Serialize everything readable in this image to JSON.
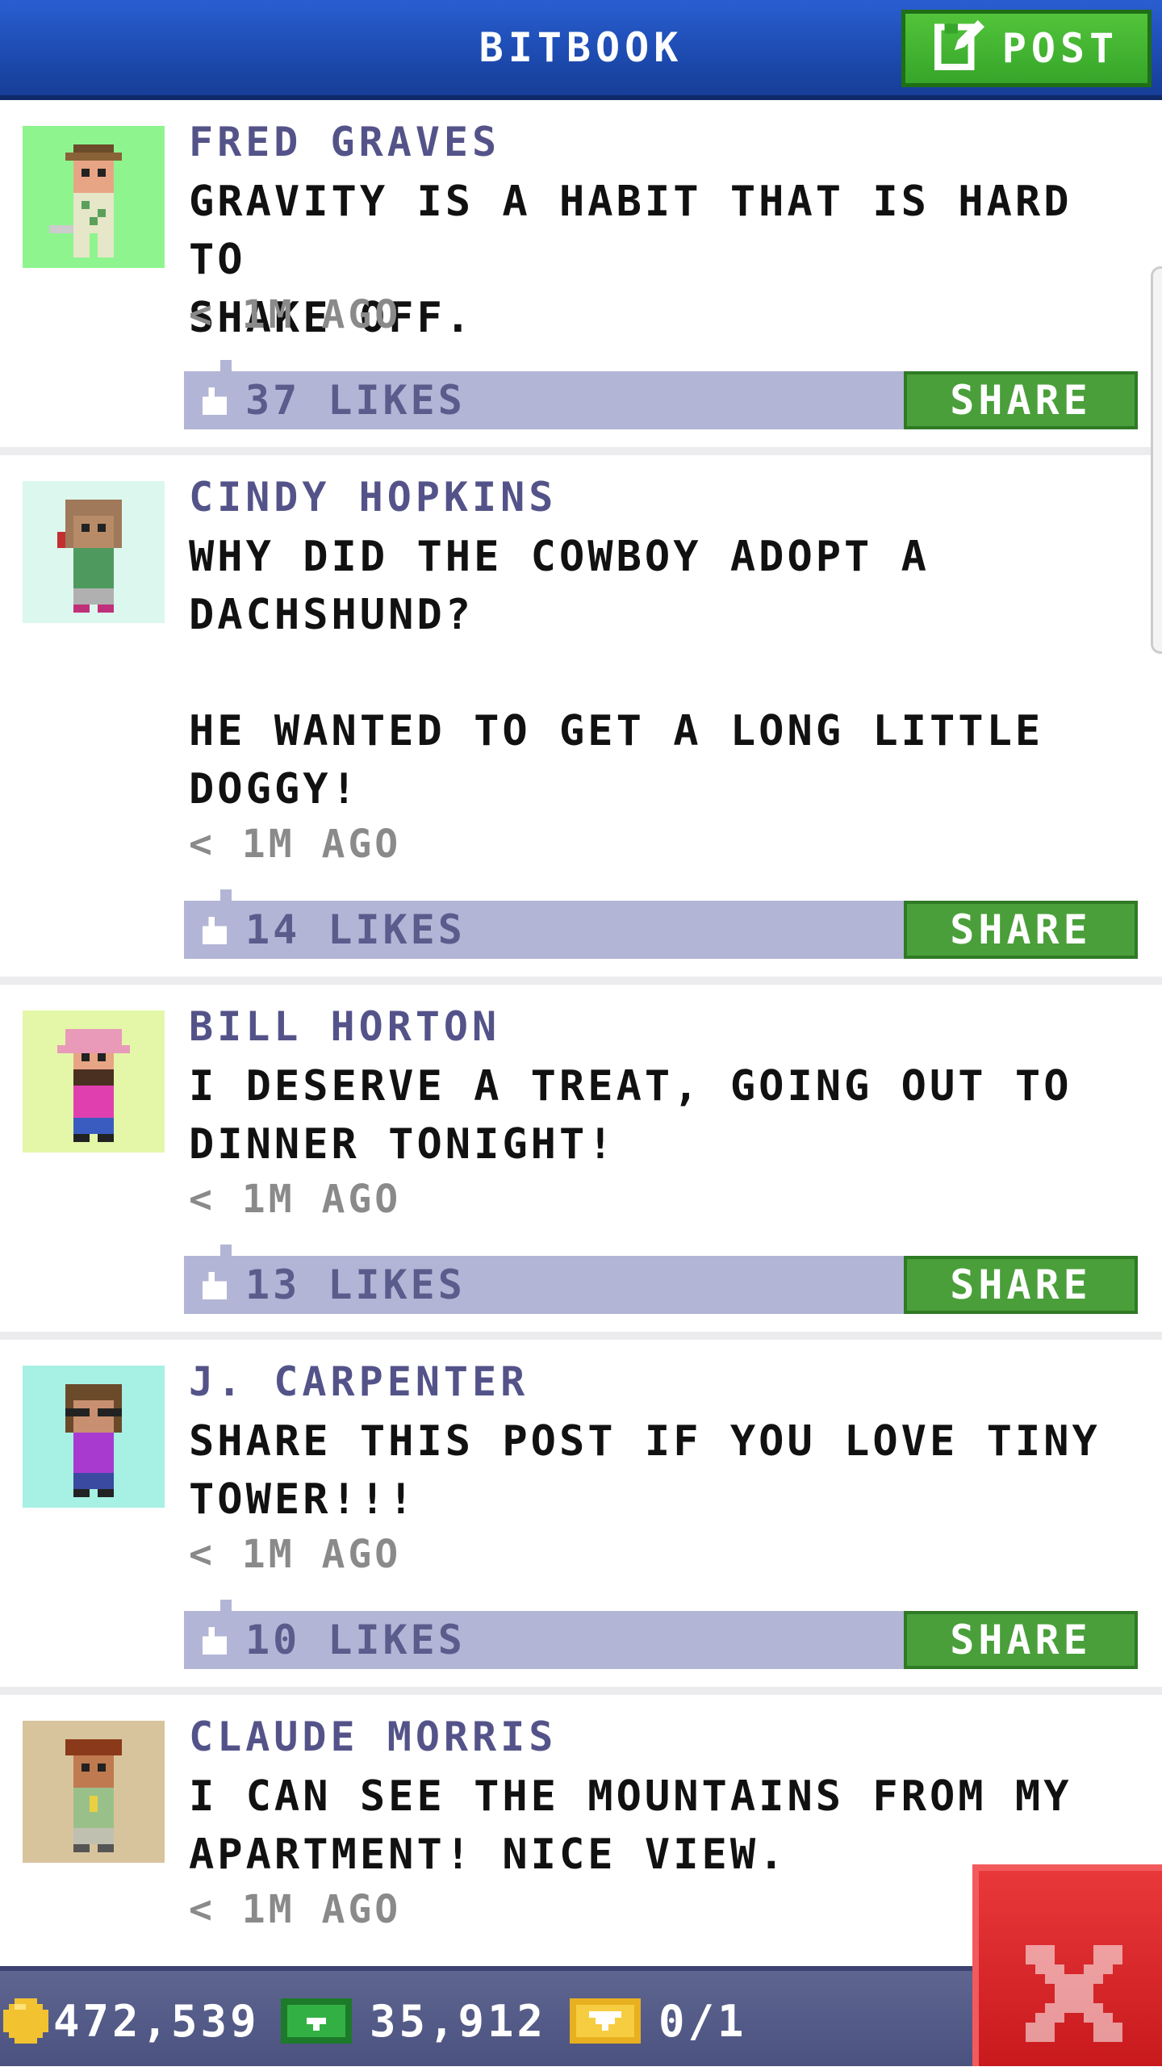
{
  "header": {
    "title": "BITBOOK",
    "post_label": "POST",
    "post_icon": "edit-icon"
  },
  "posts": [
    {
      "author": "FRED GRAVES",
      "message": "GRAVITY IS A HABIT THAT IS HARD TO\nSHAKE OFF.",
      "time": "< 1M AGO",
      "likes": "37 LIKES",
      "share_label": "SHARE",
      "avatar_bg": "#8ef58e"
    },
    {
      "author": "CINDY HOPKINS",
      "message": "WHY DID THE COWBOY ADOPT A\nDACHSHUND?\n\nHE WANTED TO GET A LONG LITTLE\nDOGGY!",
      "time": "< 1M AGO",
      "likes": "14 LIKES",
      "share_label": "SHARE",
      "avatar_bg": "#dcf7ee"
    },
    {
      "author": "BILL HORTON",
      "message": "I DESERVE A TREAT, GOING OUT TO\nDINNER TONIGHT!",
      "time": "< 1M AGO",
      "likes": "13 LIKES",
      "share_label": "SHARE",
      "avatar_bg": "#e4f7a8"
    },
    {
      "author": "J. CARPENTER",
      "message": "SHARE THIS POST IF YOU LOVE TINY\nTOWER!!!",
      "time": "< 1M AGO",
      "likes": "10 LIKES",
      "share_label": "SHARE",
      "avatar_bg": "#a6f0e4"
    },
    {
      "author": "CLAUDE MORRIS",
      "message": "I CAN SEE THE MOUNTAINS FROM MY\nAPARTMENT! NICE VIEW.",
      "time": "< 1M AGO",
      "likes": "",
      "share_label": "",
      "avatar_bg": "#d8c49c"
    }
  ],
  "footer": {
    "coins": "472,539",
    "coin_icon": "coin-icon",
    "bux": "35,912",
    "bux_icon": "bux-icon",
    "tickets": "0/1",
    "ticket_icon": "ticket-icon",
    "close_icon": "close-icon"
  },
  "colors": {
    "header_blue": "#1f4fb8",
    "post_green": "#36a52a",
    "author_purple": "#545389",
    "likes_bar": "#b3b5d6",
    "share_green": "#4a9f3a",
    "close_red": "#d8262a"
  }
}
